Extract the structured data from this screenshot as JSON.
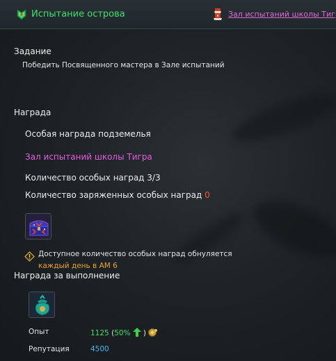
{
  "header": {
    "title": "Испытание острова",
    "dungeon_link": "Зал испытаний школы Тигра",
    "quest_icon": "green-scroll-icon",
    "link_icon": "red-tower-icon"
  },
  "task": {
    "heading": "Задание",
    "description": "Победить Посвященного мастера в Зале испытаний"
  },
  "reward": {
    "heading": "Награда",
    "special_reward": "Особая награда подземелья",
    "dungeon_name": "Зал испытаний школы Тигра",
    "special_count_label": "Количество особых наград",
    "special_count_value": "3/3",
    "charged_label": "Количество заряженных особых наград",
    "charged_value": "0",
    "item_icon": "treasure-chest-icon",
    "reset_notice": "Доступное количество особых наград обнуляется",
    "reset_schedule": "каждый день в AM 6",
    "warning_icon": "warning-icon"
  },
  "completion": {
    "heading": "Награда за выполнение",
    "item_icon": "money-pouch-icon",
    "exp_label": "Опыт",
    "exp_value": "1125",
    "exp_bonus_open": "(",
    "exp_bonus": "50%",
    "exp_bonus_close": ")",
    "reputation_label": "Репутация",
    "reputation_value": "4500"
  },
  "colors": {
    "quest_title": "#3fe06a",
    "link": "#e46ad8",
    "highlight_red": "#ff5040",
    "highlight_orange": "#f0a030",
    "exp_green": "#43e06a",
    "reputation_blue": "#4ab3f0"
  }
}
